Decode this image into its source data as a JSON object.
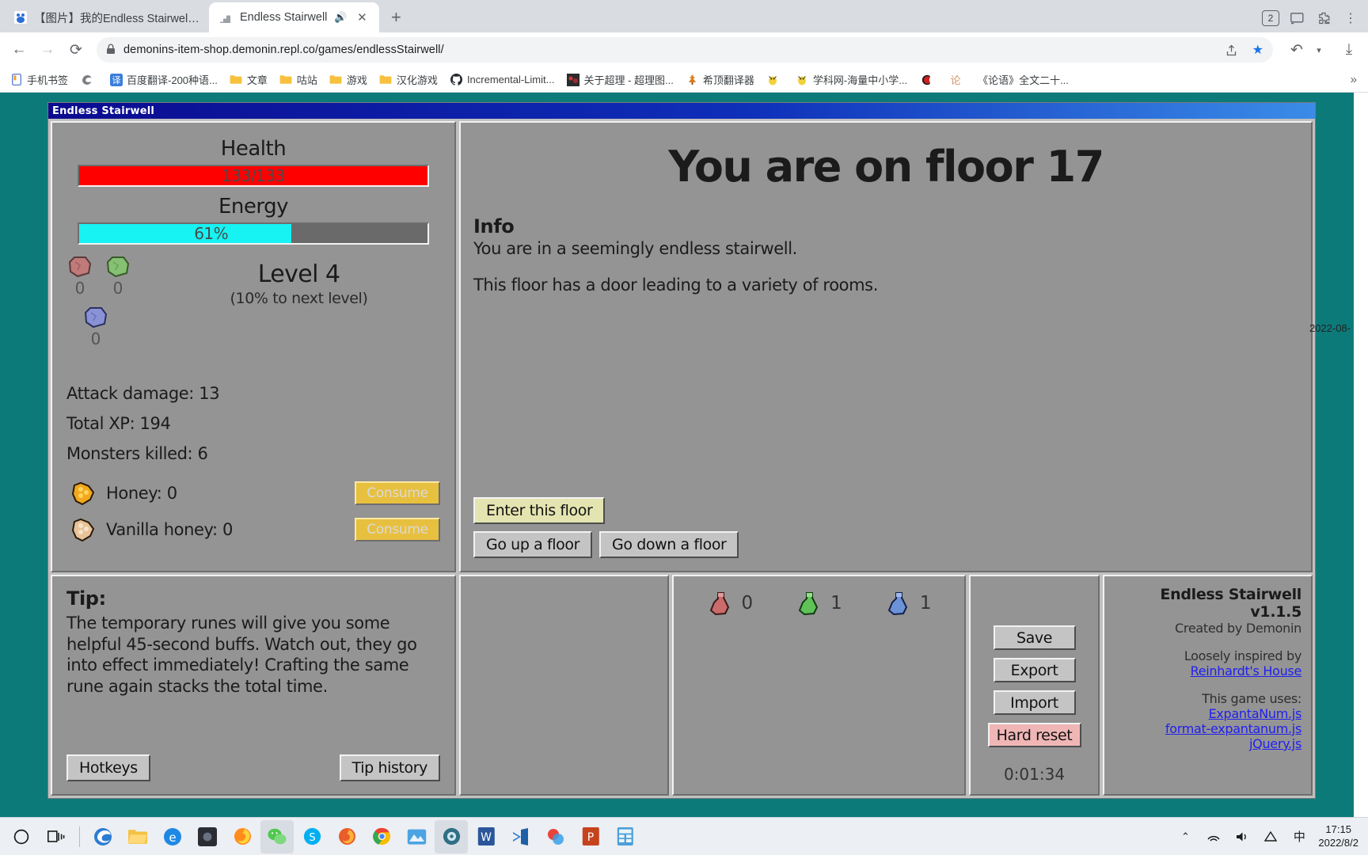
{
  "browser": {
    "tabs": [
      {
        "title": "【图片】我的Endless Stairwell速通",
        "favicon": "baidu-tieba-icon",
        "active": false,
        "audio": false
      },
      {
        "title": "Endless Stairwell",
        "favicon": "stairs-icon",
        "active": true,
        "audio": true
      }
    ],
    "new_tab_label": "+",
    "tab_count_badge": "2",
    "nav": {
      "back": "‹",
      "forward": "›",
      "reload": "⟳"
    },
    "omnibox": {
      "lock_icon": "lock-icon",
      "url": "demonins-item-shop.demonin.repl.co/games/endlessStairwell/",
      "share_icon": "share-icon",
      "bookmark_star_icon": "star-filled-icon"
    },
    "toolbar_right": {
      "undo_icon": "undo-icon",
      "download_icon": "download-icon",
      "menu_icon": "menu-icon"
    },
    "bookmarks": [
      {
        "label": "手机书签",
        "icon": "mobile-bookmarks-icon"
      },
      {
        "label": "",
        "icon": "edge-icon"
      },
      {
        "label": "百度翻译-200种语...",
        "icon": "translate-icon"
      },
      {
        "label": "文章",
        "icon": "folder-icon"
      },
      {
        "label": "咕站",
        "icon": "folder-icon"
      },
      {
        "label": "游戏",
        "icon": "folder-icon"
      },
      {
        "label": "汉化游戏",
        "icon": "folder-icon"
      },
      {
        "label": "Incremental-Limit...",
        "icon": "github-icon"
      },
      {
        "label": "关于超理 - 超理图...",
        "icon": "site-icon"
      },
      {
        "label": "希顶翻译器",
        "icon": "tree-icon"
      },
      {
        "label": "",
        "icon": "bird-icon"
      },
      {
        "label": "学科网-海量中小学...",
        "icon": "bird-icon"
      },
      {
        "label": "",
        "icon": "c-logo-icon"
      },
      {
        "label": "",
        "icon": "lun-icon"
      },
      {
        "label": "《论语》全文二十...",
        "icon": "text-icon"
      }
    ],
    "bookmarks_overflow": "»"
  },
  "game": {
    "window_title": "Endless Stairwell",
    "health": {
      "label": "Health",
      "text": "133/133",
      "percent": 100,
      "color": "#fe0000"
    },
    "energy": {
      "label": "Energy",
      "text": "61%",
      "percent": 61,
      "color": "#17f2f2"
    },
    "runes": [
      {
        "name": "red-rune",
        "count": "0",
        "color": "#c07a7a"
      },
      {
        "name": "green-rune",
        "count": "0",
        "color": "#86c072"
      },
      {
        "name": "blue-rune",
        "count": "0",
        "color": "#8a92d6"
      }
    ],
    "level": {
      "title": "Level 4",
      "subtitle": "(10% to next level)"
    },
    "stats": [
      "Attack damage: 13",
      "Total XP: 194",
      "Monsters killed: 6"
    ],
    "items": [
      {
        "label": "Honey: 0",
        "icon": "honey-icon",
        "button": "Consume"
      },
      {
        "label": "Vanilla honey: 0",
        "icon": "vanilla-honey-icon",
        "button": "Consume"
      }
    ],
    "floor": {
      "title": "You are on floor 17",
      "info_head": "Info",
      "info_lines": [
        "You are in a seemingly endless stairwell.",
        "This floor has a door leading to a variety of rooms."
      ],
      "enter_button": "Enter this floor",
      "up_button": "Go up a floor",
      "down_button": "Go down a floor"
    },
    "tip": {
      "head": "Tip:",
      "text": "The temporary runes will give you some helpful 45-second buffs. Watch out, they go into effect immediately! Crafting the same rune again stacks the total time.",
      "hotkeys_button": "Hotkeys",
      "history_button": "Tip history"
    },
    "potions": [
      {
        "name": "red-potion",
        "count": "0",
        "color": "#cc6b6b"
      },
      {
        "name": "green-potion",
        "count": "1",
        "color": "#5fc257"
      },
      {
        "name": "blue-potion",
        "count": "1",
        "color": "#6c93d8"
      }
    ],
    "save": {
      "save_button": "Save",
      "export_button": "Export",
      "import_button": "Import",
      "hard_reset_button": "Hard reset",
      "timer": "0:01:34"
    },
    "credits": {
      "title": "Endless Stairwell v1.1.5",
      "author": "Created by Demonin",
      "inspired_label": "Loosely inspired by",
      "inspired_link": "Reinhardt's House",
      "uses_label": "This game uses:",
      "links": [
        "ExpantaNum.js",
        "format-expantanum.js",
        "jQuery.js"
      ]
    }
  },
  "overlay": {
    "date_line": "2022-08-"
  },
  "taskbar": {
    "start_icon": "start-circle-icon",
    "task_view_icon": "task-view-icon",
    "apps": [
      {
        "name": "edge-icon",
        "active": false
      },
      {
        "name": "file-explorer-icon",
        "active": false
      },
      {
        "name": "edge-legacy-icon",
        "active": false
      },
      {
        "name": "dark-app-icon",
        "active": false
      },
      {
        "name": "firefox-icon",
        "active": false
      },
      {
        "name": "wechat-icon",
        "active": true
      },
      {
        "name": "skype-icon",
        "active": false
      },
      {
        "name": "firefox-alt-icon",
        "active": false
      },
      {
        "name": "chrome-icon",
        "active": false
      },
      {
        "name": "photos-icon",
        "active": false
      },
      {
        "name": "game-icon",
        "active": true
      },
      {
        "name": "word-icon",
        "active": false
      },
      {
        "name": "vscode-icon",
        "active": false
      },
      {
        "name": "colors-icon",
        "active": false
      },
      {
        "name": "powerpoint-icon",
        "active": false
      },
      {
        "name": "calculator-icon",
        "active": false
      }
    ],
    "tray": {
      "chevron": "⌃",
      "network_icon": "network-icon",
      "volume_icon": "volume-icon",
      "ime_icon": "ime-icon",
      "ime_label": "中",
      "time": "17:15",
      "date": "2022/8/2"
    }
  }
}
